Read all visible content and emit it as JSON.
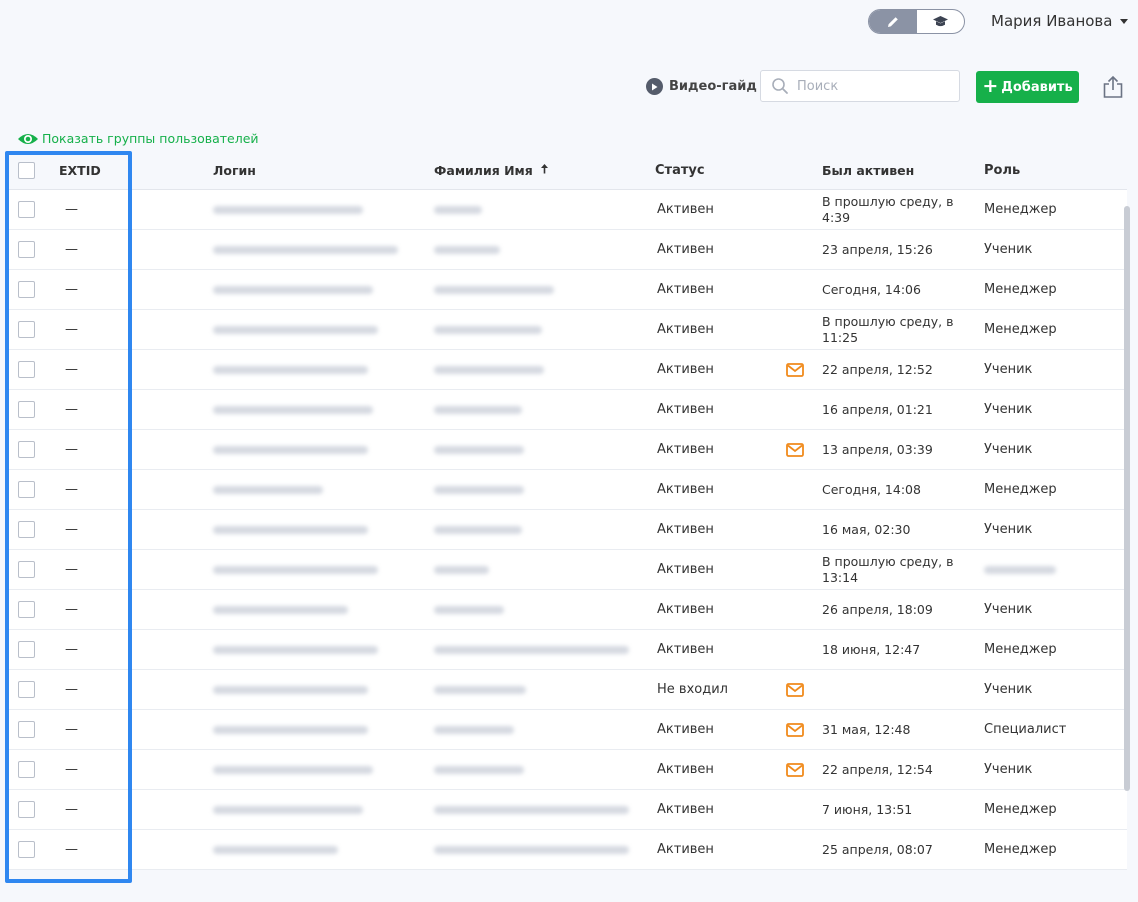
{
  "header": {
    "user_name": "Мария Иванова"
  },
  "toolbar": {
    "video_guide_label": "Видео-гайд",
    "search_placeholder": "Поиск",
    "search_value": "",
    "add_label": "Добавить"
  },
  "show_groups_label": "Показать группы пользователей",
  "table": {
    "headers": {
      "extid": "EXTID",
      "login": "Логин",
      "name": "Фамилия Имя",
      "status": "Статус",
      "last_active": "Был активен",
      "role": "Роль"
    },
    "rows": [
      {
        "extid": "—",
        "status": "Активен",
        "invite": false,
        "last_active": "В прошлую среду, в 4:39",
        "role": "Менеджер"
      },
      {
        "extid": "—",
        "status": "Активен",
        "invite": false,
        "last_active": "23 апреля, 15:26",
        "role": "Ученик"
      },
      {
        "extid": "—",
        "status": "Активен",
        "invite": false,
        "last_active": "Сегодня, 14:06",
        "role": "Менеджер"
      },
      {
        "extid": "—",
        "status": "Активен",
        "invite": false,
        "last_active": "В прошлую среду, в 11:25",
        "role": "Менеджер"
      },
      {
        "extid": "—",
        "status": "Активен",
        "invite": true,
        "last_active": "22 апреля, 12:52",
        "role": "Ученик"
      },
      {
        "extid": "—",
        "status": "Активен",
        "invite": false,
        "last_active": "16 апреля, 01:21",
        "role": "Ученик"
      },
      {
        "extid": "—",
        "status": "Активен",
        "invite": true,
        "last_active": "13 апреля, 03:39",
        "role": "Ученик"
      },
      {
        "extid": "—",
        "status": "Активен",
        "invite": false,
        "last_active": "Сегодня, 14:08",
        "role": "Менеджер"
      },
      {
        "extid": "—",
        "status": "Активен",
        "invite": false,
        "last_active": "16 мая, 02:30",
        "role": "Ученик"
      },
      {
        "extid": "—",
        "status": "Активен",
        "invite": false,
        "last_active": "В прошлую среду, в 13:14",
        "role": ""
      },
      {
        "extid": "—",
        "status": "Активен",
        "invite": false,
        "last_active": "26 апреля, 18:09",
        "role": "Ученик"
      },
      {
        "extid": "—",
        "status": "Активен",
        "invite": false,
        "last_active": "18 июня, 12:47",
        "role": "Менеджер"
      },
      {
        "extid": "—",
        "status": "Не входил",
        "invite": true,
        "last_active": "",
        "role": "Ученик"
      },
      {
        "extid": "—",
        "status": "Активен",
        "invite": true,
        "last_active": "31 мая, 12:48",
        "role": "Специалист"
      },
      {
        "extid": "—",
        "status": "Активен",
        "invite": true,
        "last_active": "22 апреля, 12:54",
        "role": "Ученик"
      },
      {
        "extid": "—",
        "status": "Активен",
        "invite": false,
        "last_active": "7 июня, 13:51",
        "role": "Менеджер"
      },
      {
        "extid": "—",
        "status": "Активен",
        "invite": false,
        "last_active": "25 апреля, 08:07",
        "role": "Менеджер"
      }
    ]
  },
  "icons": {
    "edit": "pencil-icon",
    "learner_mode": "graduation-cap-icon",
    "video_guide": "play-icon",
    "search": "search-icon",
    "add": "plus-icon",
    "export": "share-icon",
    "show_groups": "eye-icon",
    "invite": "envelope-icon",
    "sort": "arrow-up-icon"
  },
  "colors": {
    "accent_green": "#16b04a",
    "invite_orange": "#f08a1c",
    "highlight_blue": "#2f87f0"
  }
}
